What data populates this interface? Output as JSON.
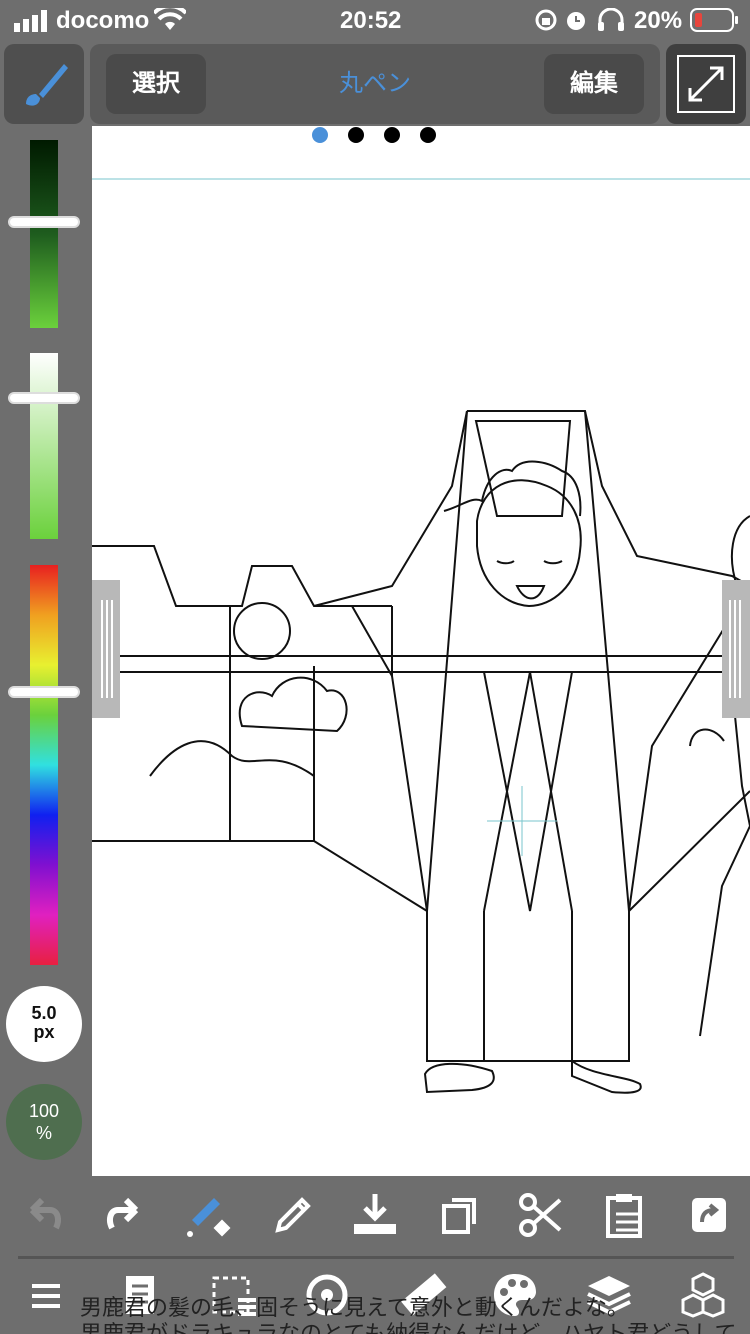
{
  "status_bar": {
    "carrier": "docomo",
    "time": "20:52",
    "battery_percent": "20%"
  },
  "toolbar": {
    "select_label": "選択",
    "tool_name": "丸ペン",
    "edit_label": "編集",
    "page_dots_count": 4,
    "active_page": 1
  },
  "brush": {
    "size_value": "5.0",
    "size_unit": "px",
    "opacity_value": "100",
    "opacity_unit": "%"
  },
  "caption": {
    "line1": "男鹿君の髪の毛、固そうに見えて意外と動くんだよな。",
    "line2": "男鹿君がドラキュラなのとても納得なんだけど、ハヤト君どうして"
  },
  "colors": {
    "accent": "#4a90d9",
    "panel": "#6e6e6e",
    "button_dark": "#4f4f4f",
    "battery_low": "#e8453c"
  },
  "icons": {
    "top": [
      "brush-icon",
      "fullscreen-icon"
    ],
    "bottom_row1": [
      "undo-icon",
      "redo-icon",
      "transform-icon",
      "eyedropper-icon",
      "save-icon",
      "copy-icon",
      "cut-icon",
      "paste-icon",
      "share-icon"
    ],
    "bottom_row2": [
      "menu-icon",
      "pages-icon",
      "selection-icon",
      "rotate-icon",
      "ruler-icon",
      "palette-icon",
      "layers-icon",
      "materials-icon"
    ]
  }
}
